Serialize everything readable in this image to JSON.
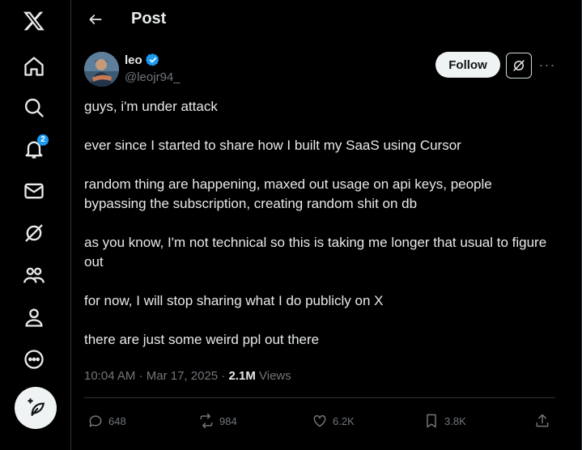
{
  "sidebar": {
    "notifications_badge": "2"
  },
  "header": {
    "title": "Post"
  },
  "post": {
    "author": {
      "name": "leo",
      "handle": "@leojr94_"
    },
    "follow_label": "Follow",
    "paragraphs": [
      "guys, i'm under attack",
      "ever since I started to share how I built my SaaS using Cursor",
      "random thing are happening, maxed out usage on api keys, people bypassing the subscription, creating random shit on db",
      "as you know, I'm not technical so this is taking me longer that usual to figure out",
      "for now, I will stop sharing what I do publicly on X",
      "there are just some weird ppl out there"
    ],
    "time": "10:04 AM",
    "date": "Mar 17, 2025",
    "views_count": "2.1M",
    "views_label": "Views",
    "stats": {
      "replies": "648",
      "reposts": "984",
      "likes": "6.2K",
      "bookmarks": "3.8K"
    }
  },
  "colors": {
    "background": "#000000",
    "text": "#e7e9ea",
    "muted": "#71767b",
    "accent": "#1d9bf0"
  }
}
